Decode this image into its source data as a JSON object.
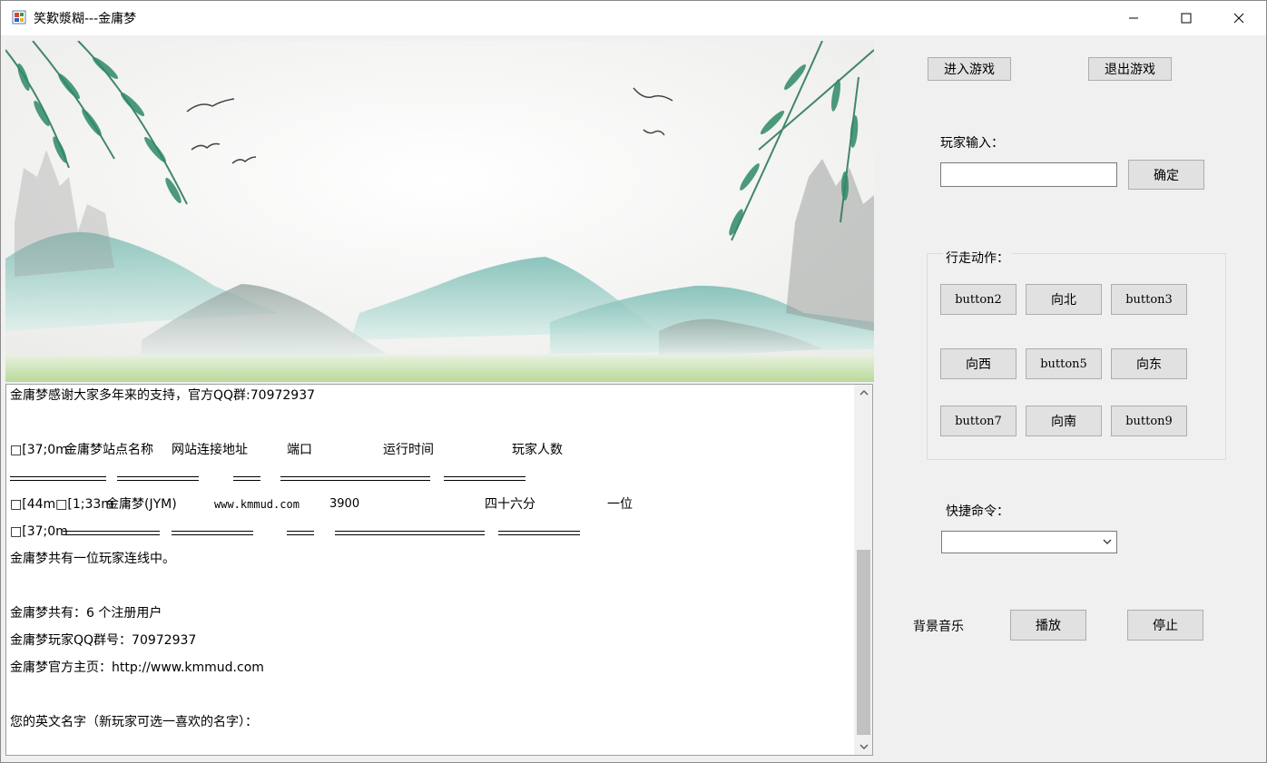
{
  "window": {
    "title": "笑歎漿糊---金庸梦",
    "icons": {
      "app": "app-icon",
      "minimize": "minimize-icon",
      "maximize": "maximize-icon",
      "close": "close-icon"
    }
  },
  "log": {
    "lines": {
      "l1": "金庸梦感谢大家多年来的支持，官方QQ群:70972937",
      "header_prefix": "□[37;0m",
      "h_site": "金庸梦站点名称",
      "h_url": "网站连接地址",
      "h_port": "端口",
      "h_time": "运行时间",
      "h_players": "玩家人数",
      "row_prefix": "□[44m□[1;33m",
      "row_site": "金庸梦(JYM)",
      "row_url": "www.kmmud.com",
      "row_port": "3900",
      "row_time": "四十六分",
      "row_players": "一位",
      "row2_prefix": "□[37;0m",
      "l_online": "金庸梦共有一位玩家连线中。",
      "l_users": "金庸梦共有：6 个注册用户",
      "l_qq": "金庸梦玩家QQ群号：70972937",
      "l_home": "金庸梦官方主页：http://www.kmmud.com",
      "l_prompt": "您的英文名字（新玩家可选一喜欢的名字）："
    }
  },
  "controls": {
    "enter_game": "进入游戏",
    "exit_game": "退出游戏",
    "player_input_label": "玩家输入：",
    "player_input_value": "",
    "confirm": "确定",
    "walk_group": "行走动作：",
    "walk": {
      "b2": "button2",
      "north": "向北",
      "b3": "button3",
      "west": "向西",
      "b5": "button5",
      "east": "向东",
      "b7": "button7",
      "south": "向南",
      "b9": "button9"
    },
    "shortcut_label": "快捷命令：",
    "shortcut_value": "",
    "music_label": "背景音乐",
    "play": "播放",
    "stop": "停止"
  }
}
